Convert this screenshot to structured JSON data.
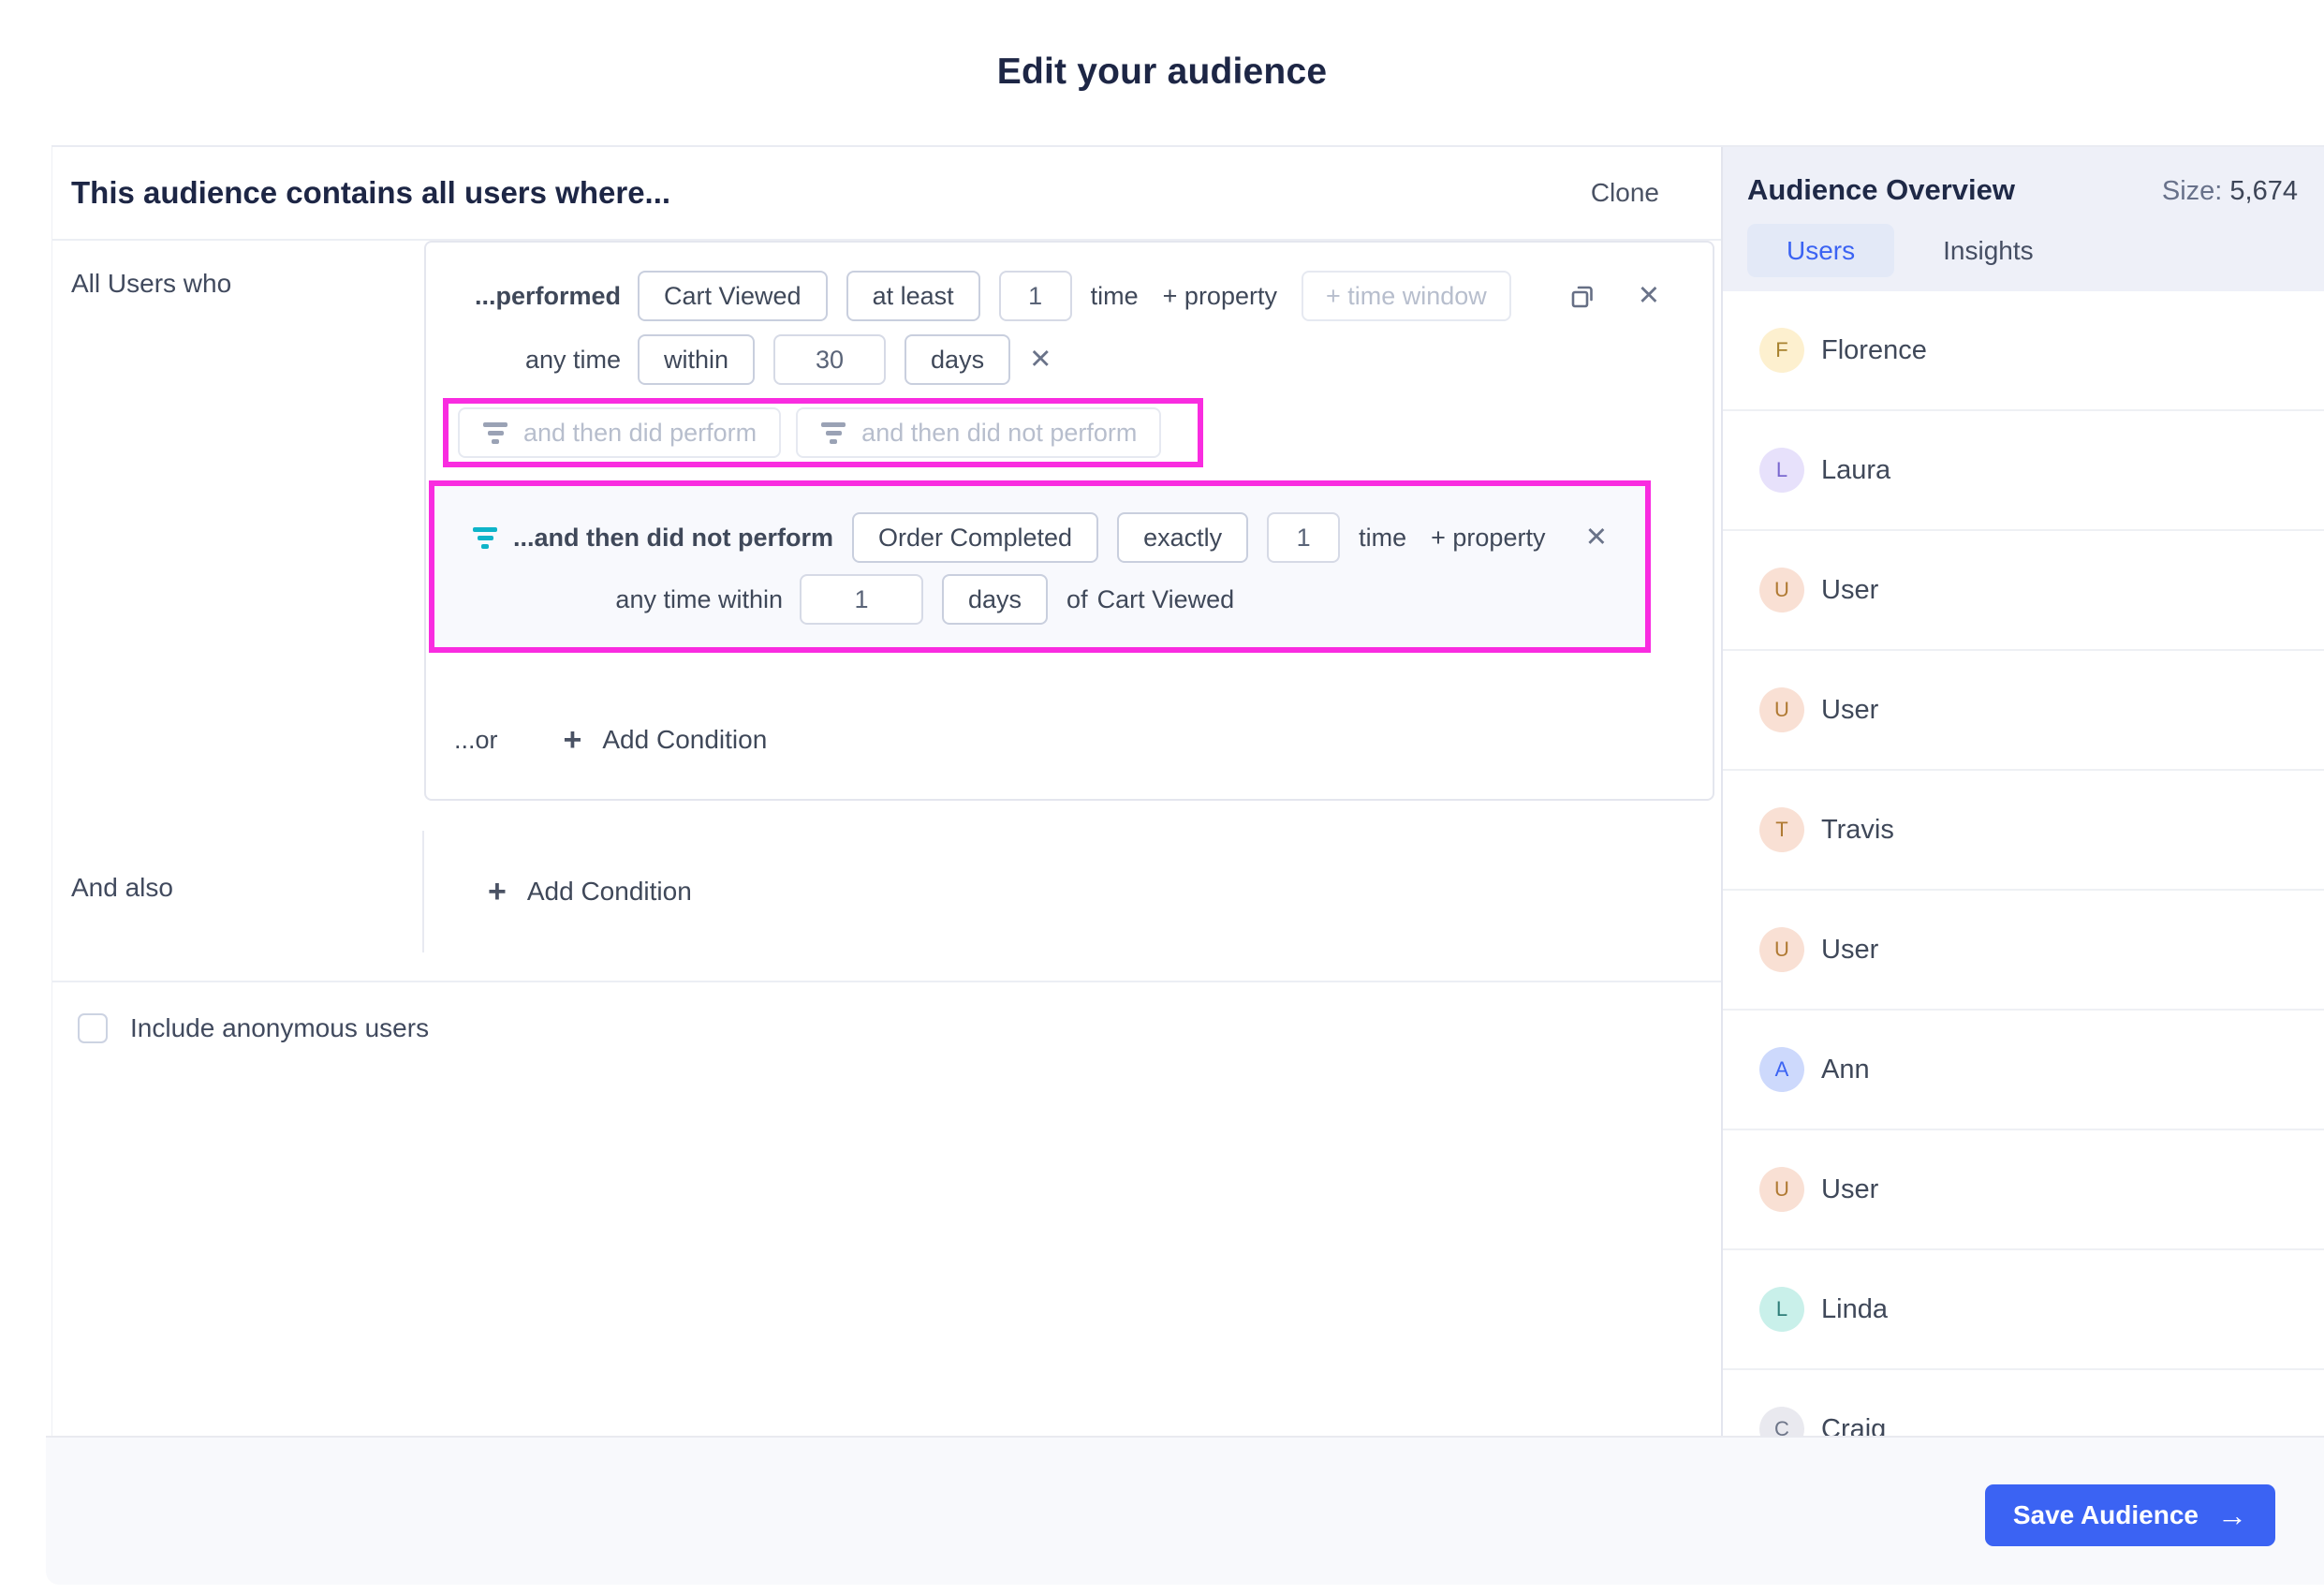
{
  "page_title": "Edit your audience",
  "colors": {
    "highlight_pink": "#f92ce0",
    "accent_blue": "#3b63f3",
    "funnel_teal": "#0eb4c9"
  },
  "editor": {
    "heading": "This audience contains all users where...",
    "clone_label": "Clone",
    "section1_label": "All Users who",
    "condition": {
      "performed_label": "...performed",
      "event_button": "Cart Viewed",
      "operator_button": "at least",
      "count_value": "1",
      "time_label": "time",
      "add_property_label": "+ property",
      "time_window_placeholder": "+ time window",
      "anytime_label": "any time",
      "within_button": "within",
      "within_value": "30",
      "unit_button": "days",
      "close_glyph": "✕"
    },
    "funnel_buttons": {
      "did_perform_label": "and then did perform",
      "did_not_perform_label": "and then did not perform"
    },
    "subcondition": {
      "label": "...and then did not perform",
      "event_button": "Order Completed",
      "operator_button": "exactly",
      "count_value": "1",
      "time_label": "time",
      "add_property_label": "+ property",
      "anytime_within_label": "any time within",
      "within_value": "1",
      "unit_button": "days",
      "of_label": "of",
      "of_event": "Cart Viewed",
      "close_glyph": "✕"
    },
    "or_label": "...or",
    "or_add_condition_label": "Add Condition",
    "and_also_label": "And also",
    "and_also_add_condition_label": "Add Condition",
    "plus_glyph": "+",
    "anonymous_checkbox_label": "Include anonymous users"
  },
  "overview": {
    "title": "Audience Overview",
    "size_label": "Size:",
    "size_value": "5,674",
    "tabs": [
      {
        "label": "Users",
        "active": true
      },
      {
        "label": "Insights",
        "active": false
      }
    ],
    "users": [
      {
        "name": "Florence",
        "initial": "F",
        "avatar_bg": "#fdf0cf",
        "avatar_fg": "#a8822f"
      },
      {
        "name": "Laura",
        "initial": "L",
        "avatar_bg": "#e7e1fb",
        "avatar_fg": "#7a68cf"
      },
      {
        "name": "User",
        "initial": "U",
        "avatar_bg": "#f9e0d4",
        "avatar_fg": "#b07a33"
      },
      {
        "name": "User",
        "initial": "U",
        "avatar_bg": "#f9e0d4",
        "avatar_fg": "#b07a33"
      },
      {
        "name": "Travis",
        "initial": "T",
        "avatar_bg": "#f9e0d4",
        "avatar_fg": "#b07a33"
      },
      {
        "name": "User",
        "initial": "U",
        "avatar_bg": "#f9e0d4",
        "avatar_fg": "#b07a33"
      },
      {
        "name": "Ann",
        "initial": "A",
        "avatar_bg": "#cdd9fc",
        "avatar_fg": "#3b63f3"
      },
      {
        "name": "User",
        "initial": "U",
        "avatar_bg": "#f9e0d4",
        "avatar_fg": "#b07a33"
      },
      {
        "name": "Linda",
        "initial": "L",
        "avatar_bg": "#c9f0ea",
        "avatar_fg": "#2f7d78"
      },
      {
        "name": "Craig",
        "initial": "C",
        "avatar_bg": "#e9e9ef",
        "avatar_fg": "#6d7588"
      }
    ]
  },
  "footer": {
    "save_label": "Save Audience",
    "arrow_glyph": "→"
  }
}
